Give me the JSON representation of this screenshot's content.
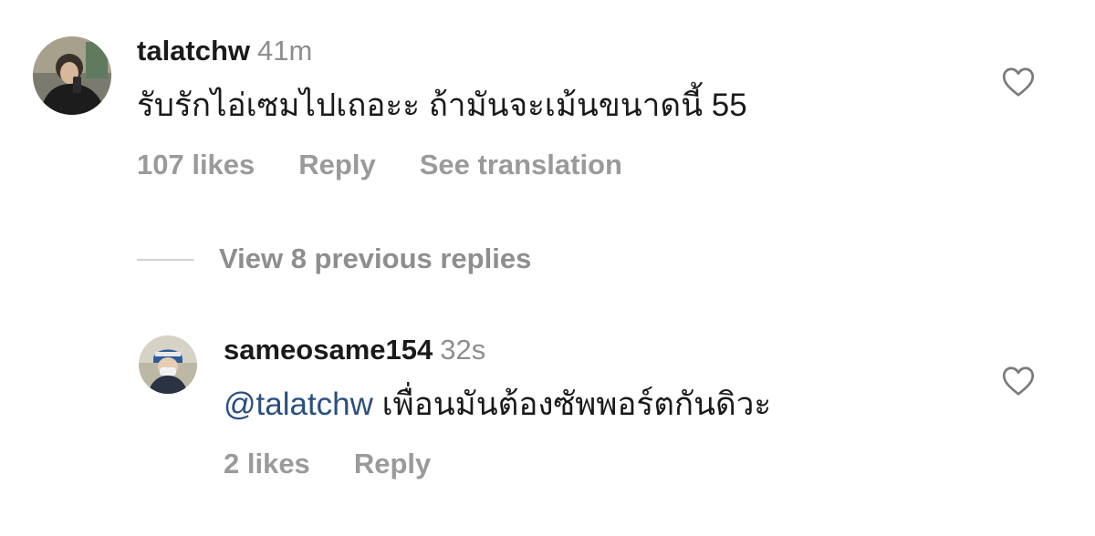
{
  "comment": {
    "username": "talatchw",
    "time": "41m",
    "text": "รับรักไอ่เซมไปเถอะะ ถ้ามันจะเม้นขนาดนี้ 55",
    "likes": "107 likes",
    "reply": "Reply",
    "see_translation": "See translation"
  },
  "view_replies": {
    "label": "View 8 previous replies"
  },
  "reply": {
    "username": "sameosame154",
    "time": "32s",
    "mention": "@talatchw",
    "text": "เพื่อนมันต้องซัพพอร์ตกันดิวะ",
    "likes": "2 likes",
    "reply": "Reply"
  },
  "icons": {
    "like": "heart-outline-icon"
  },
  "colors": {
    "mention": "#2b4f7e",
    "secondary_text": "#8e8e8e",
    "action_text": "#9a9a9a"
  }
}
